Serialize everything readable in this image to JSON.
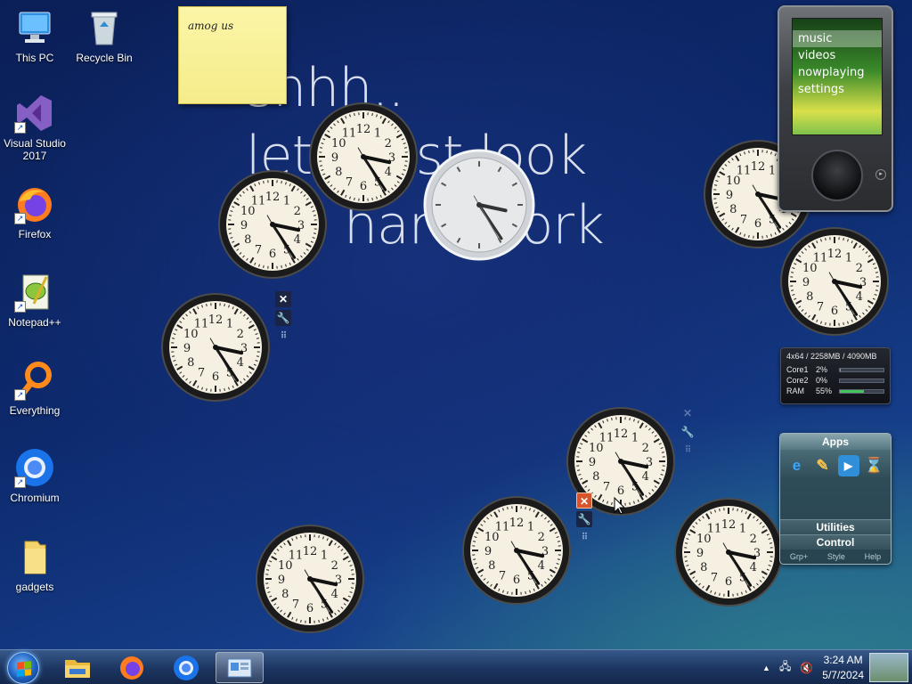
{
  "desktop_icons": [
    {
      "label": "This PC",
      "icon": "computer-icon"
    },
    {
      "label": "Recycle Bin",
      "icon": "recycle-bin-icon"
    },
    {
      "label": "Visual Studio 2017",
      "icon": "visual-studio-icon"
    },
    {
      "label": "Firefox",
      "icon": "firefox-icon"
    },
    {
      "label": "Notepad++",
      "icon": "notepadpp-icon"
    },
    {
      "label": "Everything",
      "icon": "everything-icon"
    },
    {
      "label": "Chromium",
      "icon": "chromium-icon"
    },
    {
      "label": "gadgets",
      "icon": "folder-icon"
    }
  ],
  "wallpaper": {
    "line1": "shhh..",
    "line2": "let's just look",
    "line3": "hard work"
  },
  "sticky_note": {
    "text": "amog us"
  },
  "clock_time": {
    "hour": 3,
    "minute": 24,
    "second": 25
  },
  "zune_gadget": {
    "menu": [
      "music",
      "videos",
      "nowplaying",
      "settings"
    ],
    "selected": "music"
  },
  "cpu_meter": {
    "header": "4x64 / 2258MB / 4090MB",
    "rows": [
      {
        "name": "Core1",
        "pct": "2%",
        "value": 2
      },
      {
        "name": "Core2",
        "pct": "0%",
        "value": 0
      },
      {
        "name": "RAM",
        "pct": "55%",
        "value": 55
      }
    ]
  },
  "apps_gadget": {
    "title": "Apps",
    "sections": [
      "Utilities",
      "Control"
    ],
    "footer": [
      "Grp+",
      "Style",
      "Help"
    ]
  },
  "taskbar": {
    "pinned": [
      "file-explorer-icon",
      "firefox-icon",
      "chromium-icon",
      "control-panel-icon"
    ],
    "time": "3:24 AM",
    "date": "5/7/2024"
  },
  "colors": {
    "accent": "#1d5fbf",
    "sticky": "#f6ec8a",
    "cpu_bar": "#45c45b"
  }
}
